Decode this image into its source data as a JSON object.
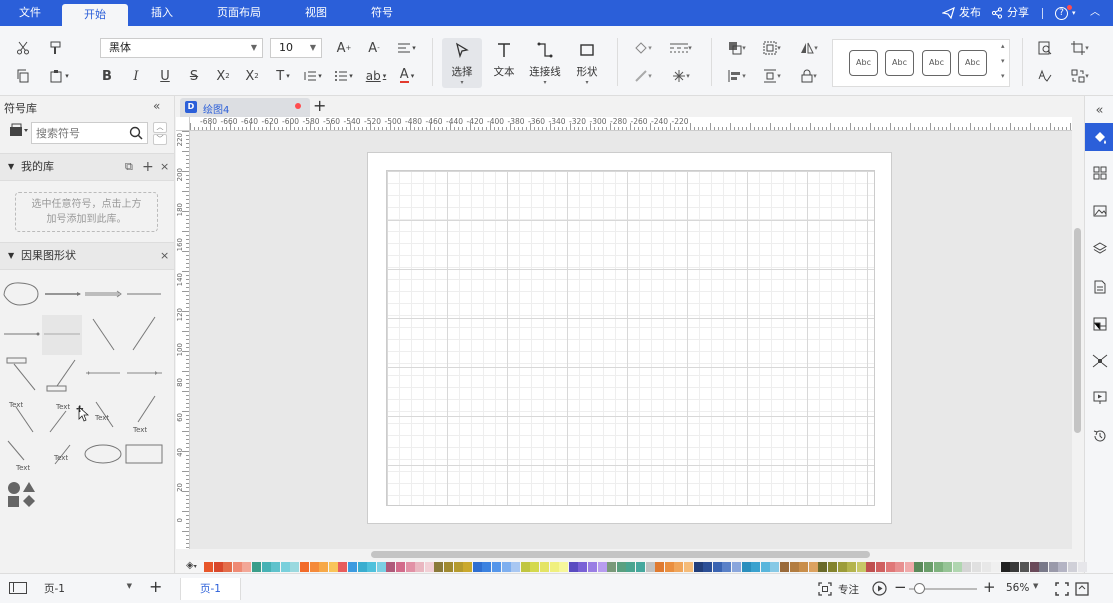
{
  "menu": {
    "file": "文件",
    "home": "开始",
    "insert": "插入",
    "layout": "页面布局",
    "view": "视图",
    "symbol": "符号"
  },
  "top_right": {
    "publish": "发布",
    "share": "分享",
    "help": "?"
  },
  "ribbon": {
    "font": "黑体",
    "font_size": "10",
    "select": "选择",
    "text": "文本",
    "connector": "连接线",
    "shape": "形状",
    "style_sample": "Abc"
  },
  "left": {
    "title": "符号库",
    "search_placeholder": "搜索符号",
    "mylib": "我的库",
    "mylib_hint_1": "选中任意符号，点击上方",
    "mylib_hint_2": "加号添加到此库。",
    "shapes_title": "因果图形状",
    "text_label": "Text"
  },
  "doc": {
    "tab": "绘图4",
    "add": "+"
  },
  "ruler_top": [
    "-680",
    "-660",
    "-640",
    "-620",
    "-600",
    "-580",
    "-560",
    "-540",
    "-520",
    "-500",
    "-480",
    "-460",
    "-440",
    "-420",
    "-400",
    "-380",
    "-360",
    "-340",
    "-320",
    "-300",
    "-280",
    "-260",
    "-240",
    "-220"
  ],
  "ruler_left": [
    "220",
    "200",
    "180",
    "160",
    "140",
    "120",
    "100",
    "80",
    "60",
    "40",
    "20",
    "0"
  ],
  "status": {
    "page_select": "页-1",
    "add_page": "+",
    "page_tab": "页-1",
    "focus": "专注",
    "zoom": "56%"
  },
  "colors": {
    "accent": "#2b5fd9",
    "palette": [
      "#e8562a",
      "#d9482b",
      "#e46d4a",
      "#ef8a74",
      "#f3a797",
      "#3a9e8a",
      "#47b2b5",
      "#5fc2cc",
      "#79d0dc",
      "#9ad9df",
      "#f26b2a",
      "#f58a3a",
      "#f7a948",
      "#f9c55a",
      "#e85d5d",
      "#3c9be0",
      "#3aaed0",
      "#4fc1dc",
      "#7cd0e4",
      "#b05a7a",
      "#d36b8b",
      "#e291a6",
      "#eab7c1",
      "#f2d0d6",
      "#8a7a3a",
      "#a08a30",
      "#b59b2e",
      "#caa92e",
      "#2f6fd1",
      "#3c82e0",
      "#5596ea",
      "#7eafef",
      "#a8c7f2",
      "#c1c640",
      "#d4d94e",
      "#e4e465",
      "#f0f07e",
      "#f7f79c",
      "#5a4cc1",
      "#7a62d6",
      "#9a7ee4",
      "#b89df0",
      "#7a9a7a",
      "#5aa080",
      "#4aa590",
      "#46a89e",
      "#c1c1c1",
      "#e07a30",
      "#ea8f40",
      "#f0a55a",
      "#f5bb78",
      "#223e7a",
      "#2c4f96",
      "#3a64b2",
      "#5a81c8",
      "#8aa6dc",
      "#2b8fbd",
      "#3aa2cf",
      "#59b6dc",
      "#86c9e6",
      "#9a6a3a",
      "#b27c40",
      "#c98e4a",
      "#dca260",
      "#6a6a2a",
      "#84842e",
      "#9c9c3a",
      "#b4b44e",
      "#c8c868",
      "#c05050",
      "#d06060",
      "#e07878",
      "#e89090",
      "#f0aaaa",
      "#5a8a5a",
      "#6a9e6a",
      "#7eb27e",
      "#96c496",
      "#b0d6b0",
      "#d5d5d5",
      "#e0e0e0",
      "#e8e8e8",
      "#f0f0f0",
      "#222222",
      "#3a3a3a",
      "#555555",
      "#6a4a5a",
      "#7a7a8a",
      "#9a9aaa",
      "#b4b4c4",
      "#d0d0d8",
      "#e6e6ea"
    ]
  }
}
